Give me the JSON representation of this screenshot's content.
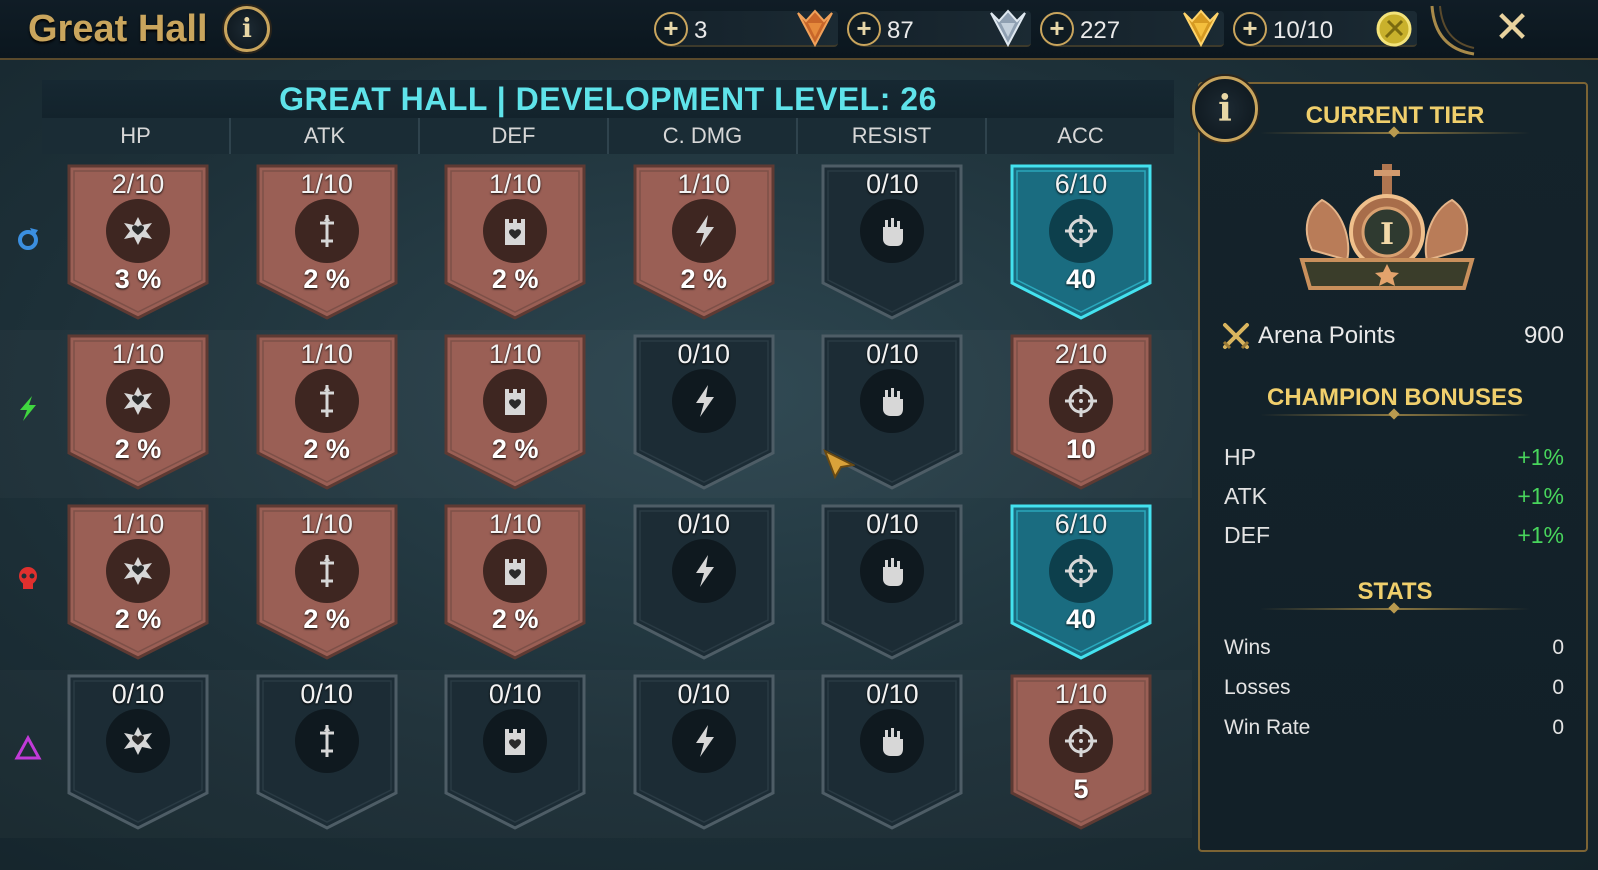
{
  "header": {
    "title": "Great Hall",
    "info_icon": "info-icon",
    "close_icon": "close-icon"
  },
  "resources": [
    {
      "value": "3",
      "icon": "bronze-medal-icon",
      "color": "#d4722c"
    },
    {
      "value": "87",
      "icon": "silver-medal-icon",
      "color": "#a9b7c6"
    },
    {
      "value": "227",
      "icon": "gold-medal-icon",
      "color": "#e0a32a"
    },
    {
      "value": "10/10",
      "icon": "arena-token-icon",
      "color": "#d9c23a"
    }
  ],
  "grid": {
    "title": "GREAT HALL | DEVELOPMENT LEVEL: 26",
    "columns": [
      "HP",
      "ATK",
      "DEF",
      "C. DMG",
      "RESIST",
      "ACC"
    ],
    "column_icons": [
      "hp-icon",
      "atk-icon",
      "def-icon",
      "crit-damage-icon",
      "resist-icon",
      "accuracy-icon"
    ],
    "rows": [
      {
        "affinity": "magic",
        "affinity_icon": "magic-affinity-icon",
        "affinity_color": "#3b8fe0",
        "cells": [
          {
            "level": "2/10",
            "value": "3 %",
            "state": "upgraded"
          },
          {
            "level": "1/10",
            "value": "2 %",
            "state": "upgraded"
          },
          {
            "level": "1/10",
            "value": "2 %",
            "state": "upgraded"
          },
          {
            "level": "1/10",
            "value": "2 %",
            "state": "upgraded"
          },
          {
            "level": "0/10",
            "value": "",
            "state": "locked"
          },
          {
            "level": "6/10",
            "value": "40",
            "state": "highlight"
          }
        ]
      },
      {
        "affinity": "spirit",
        "affinity_icon": "spirit-affinity-icon",
        "affinity_color": "#3fd63f",
        "cells": [
          {
            "level": "1/10",
            "value": "2 %",
            "state": "upgraded"
          },
          {
            "level": "1/10",
            "value": "2 %",
            "state": "upgraded"
          },
          {
            "level": "1/10",
            "value": "2 %",
            "state": "upgraded"
          },
          {
            "level": "0/10",
            "value": "",
            "state": "locked"
          },
          {
            "level": "0/10",
            "value": "",
            "state": "locked"
          },
          {
            "level": "2/10",
            "value": "10",
            "state": "upgraded"
          }
        ]
      },
      {
        "affinity": "force",
        "affinity_icon": "force-affinity-icon",
        "affinity_color": "#e0302e",
        "cells": [
          {
            "level": "1/10",
            "value": "2 %",
            "state": "upgraded"
          },
          {
            "level": "1/10",
            "value": "2 %",
            "state": "upgraded"
          },
          {
            "level": "1/10",
            "value": "2 %",
            "state": "upgraded"
          },
          {
            "level": "0/10",
            "value": "",
            "state": "locked"
          },
          {
            "level": "0/10",
            "value": "",
            "state": "locked"
          },
          {
            "level": "6/10",
            "value": "40",
            "state": "highlight"
          }
        ]
      },
      {
        "affinity": "void",
        "affinity_icon": "void-affinity-icon",
        "affinity_color": "#c23ad8",
        "cells": [
          {
            "level": "0/10",
            "value": "",
            "state": "locked"
          },
          {
            "level": "0/10",
            "value": "",
            "state": "locked"
          },
          {
            "level": "0/10",
            "value": "",
            "state": "locked"
          },
          {
            "level": "0/10",
            "value": "",
            "state": "locked"
          },
          {
            "level": "0/10",
            "value": "",
            "state": "locked"
          },
          {
            "level": "1/10",
            "value": "5",
            "state": "upgraded"
          }
        ]
      }
    ]
  },
  "panel": {
    "current_tier_heading": "CURRENT TIER",
    "tier_badge_icon": "bronze-tier-1-badge-icon",
    "arena_points_label": "Arena Points",
    "arena_points_value": "900",
    "champion_bonuses_heading": "CHAMPION BONUSES",
    "bonuses": [
      {
        "label": "HP",
        "value": "+1%"
      },
      {
        "label": "ATK",
        "value": "+1%"
      },
      {
        "label": "DEF",
        "value": "+1%"
      }
    ],
    "stats_heading": "STATS",
    "stats": [
      {
        "label": "Wins",
        "value": "0"
      },
      {
        "label": "Losses",
        "value": "0"
      },
      {
        "label": "Win Rate",
        "value": "0"
      }
    ]
  },
  "colors": {
    "gold": "#c9a55d",
    "cyan_title": "#5fe3ea",
    "upgraded_fill": "#9a5f55",
    "locked_fill": "#1c2c35",
    "highlight_fill": "#1a6c80",
    "highlight_border": "#44e2ef",
    "bonus_green": "#48d55c"
  }
}
